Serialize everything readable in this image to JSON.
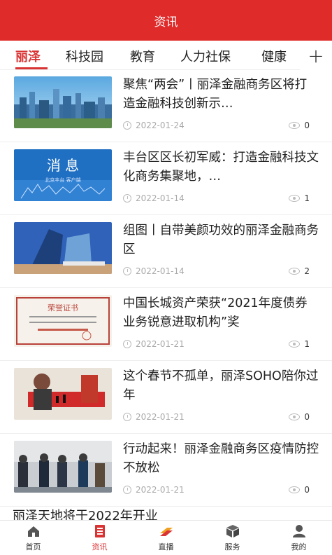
{
  "header": {
    "title": "资讯"
  },
  "tabs": [
    {
      "label": "丽泽"
    },
    {
      "label": "科技园"
    },
    {
      "label": "教育"
    },
    {
      "label": "人力社保"
    },
    {
      "label": "健康"
    }
  ],
  "add_tab_symbol": "+",
  "articles": [
    {
      "title": "聚焦“两会”丨丽泽金融商务区将打造金融科技创新示…",
      "date": "2022-01-24",
      "views": "0"
    },
    {
      "title": "丰台区区长初军威：打造金融科技文化商务集聚地，…",
      "date": "2022-01-14",
      "views": "1"
    },
    {
      "title": "组图丨自带美颜功效的丽泽金融商务区",
      "date": "2022-01-14",
      "views": "2"
    },
    {
      "title": "中国长城资产荣获“2021年度债券业务锐意进取机构”奖",
      "date": "2022-01-21",
      "views": "1"
    },
    {
      "title": "这个春节不孤单，丽泽SOHO陪你过年",
      "date": "2022-01-21",
      "views": "0"
    },
    {
      "title": "行动起来！丽泽金融商务区疫情防控不放松",
      "date": "2022-01-21",
      "views": "0"
    }
  ],
  "thumb_text": {
    "news_main": "消 息",
    "news_sub": "北京丰台 客户端",
    "cert_title": "荣誉证书"
  },
  "partial_article_title": "丽泽天地将于2022年开业",
  "bottom_nav": [
    {
      "label": "首页",
      "icon": "home-icon"
    },
    {
      "label": "资讯",
      "icon": "news-icon"
    },
    {
      "label": "直播",
      "icon": "live-icon"
    },
    {
      "label": "服务",
      "icon": "box-icon"
    },
    {
      "label": "我的",
      "icon": "user-icon"
    }
  ],
  "colors": {
    "brand_red": "#e02b2b",
    "active_red": "#d93333"
  }
}
